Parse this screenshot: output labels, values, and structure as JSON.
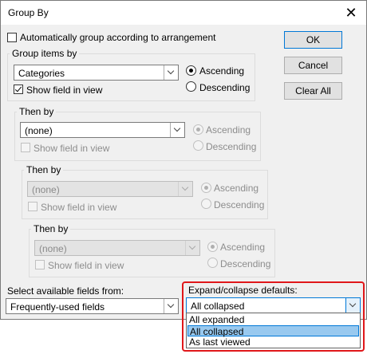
{
  "window": {
    "title": "Group By"
  },
  "auto_group": {
    "label": "Automatically group according to arrangement",
    "checked": false
  },
  "buttons": {
    "ok": "OK",
    "cancel": "Cancel",
    "clear_all": "Clear All"
  },
  "group_items": {
    "legend": "Group items by",
    "field": "Categories",
    "show_field": "Show field in view",
    "ascending": "Ascending",
    "descending": "Descending"
  },
  "then_by": [
    {
      "legend": "Then by",
      "field": "(none)",
      "show_field": "Show field in view",
      "ascending": "Ascending",
      "descending": "Descending"
    },
    {
      "legend": "Then by",
      "field": "(none)",
      "show_field": "Show field in view",
      "ascending": "Ascending",
      "descending": "Descending"
    },
    {
      "legend": "Then by",
      "field": "(none)",
      "show_field": "Show field in view",
      "ascending": "Ascending",
      "descending": "Descending"
    }
  ],
  "fields_from": {
    "label": "Select available fields from:",
    "value": "Frequently-used fields"
  },
  "expand": {
    "label": "Expand/collapse defaults:",
    "value": "All collapsed",
    "options": [
      "All expanded",
      "All collapsed",
      "As last viewed"
    ]
  }
}
